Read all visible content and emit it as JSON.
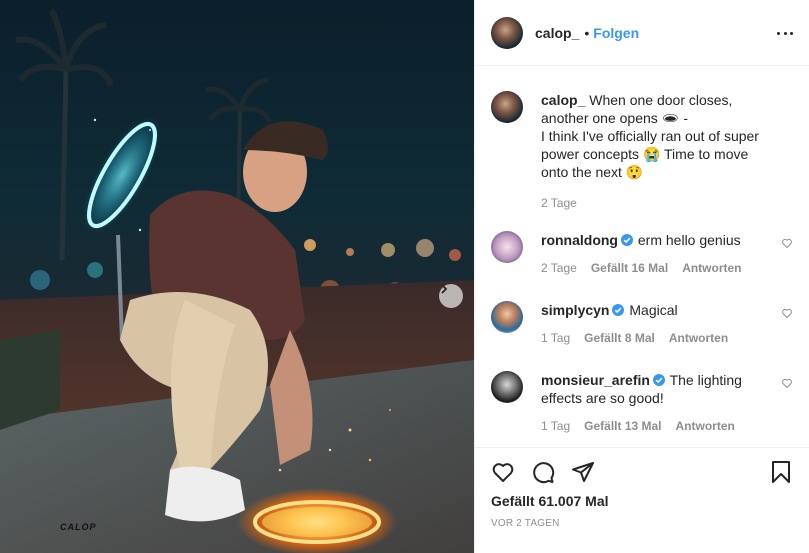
{
  "post": {
    "username": "calop_",
    "separator": "•",
    "follow_label": "Folgen",
    "more_icon": "more-options-icon",
    "watermark": "CALOP"
  },
  "caption": {
    "username": "calop_",
    "line1": "When one door closes, another one opens 🕳 -",
    "line2": "I think I've officially ran out of super power concepts 😭 Time to move onto the next 😲",
    "time": "2 Tage"
  },
  "comments": [
    {
      "username": "ronnaldong",
      "verified": true,
      "text": "erm hello genius",
      "time": "2 Tage",
      "likes": "Gefällt 16 Mal",
      "reply": "Antworten"
    },
    {
      "username": "simplycyn",
      "verified": true,
      "text": "Magical",
      "time": "1 Tag",
      "likes": "Gefällt 8 Mal",
      "reply": "Antworten"
    },
    {
      "username": "monsieur_arefin",
      "verified": true,
      "text": "The lighting effects are so good!",
      "time": "1 Tag",
      "likes": "Gefällt 13 Mal",
      "reply": "Antworten"
    }
  ],
  "footer": {
    "likes": "Gefällt 61.007 Mal",
    "age": "VOR 2 TAGEN"
  },
  "colors": {
    "accent": "#3897f0",
    "verified": "#3897f0",
    "text": "#262626",
    "muted": "#8e8e8e"
  }
}
